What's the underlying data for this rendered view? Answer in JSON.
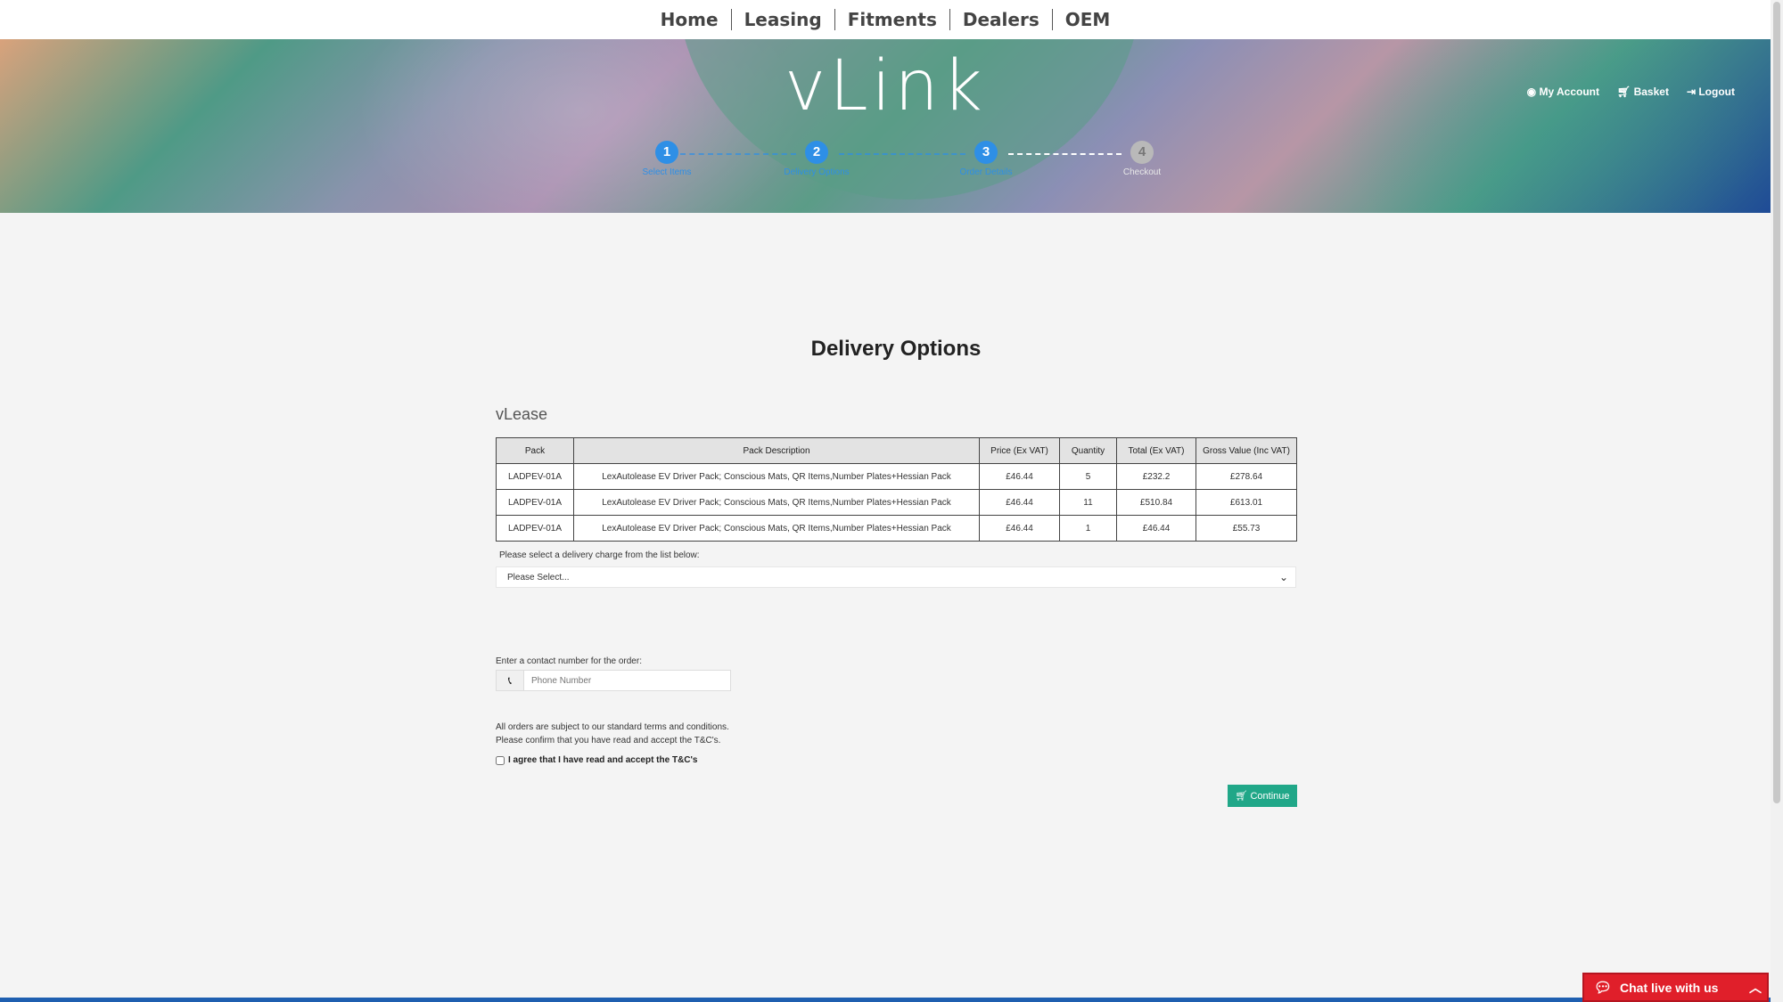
{
  "nav": {
    "items": [
      "Home",
      "Leasing",
      "Fitments",
      "Dealers",
      "OEM"
    ]
  },
  "header": {
    "logo": "vLink",
    "account": {
      "my_account": "My Account",
      "basket": "Basket",
      "logout": "Logout"
    }
  },
  "steps": [
    {
      "number": "1",
      "label": "Select Items",
      "active": true
    },
    {
      "number": "2",
      "label": "Delivery Options",
      "active": true
    },
    {
      "number": "3",
      "label": "Order Details",
      "active": true
    },
    {
      "number": "4",
      "label": "Checkout",
      "active": false
    }
  ],
  "main": {
    "title": "Delivery Options",
    "section_title": "vLease",
    "table": {
      "headers": [
        "Pack",
        "Pack Description",
        "Price (Ex VAT)",
        "Quantity",
        "Total (Ex VAT)",
        "Gross Value (Inc VAT)"
      ],
      "rows": [
        [
          "LADPEV-01A",
          "LexAutolease EV Driver Pack; Conscious Mats, QR Items,Number Plates+Hessian Pack",
          "£46.44",
          "5",
          "£232.2",
          "£278.64"
        ],
        [
          "LADPEV-01A",
          "LexAutolease EV Driver Pack; Conscious Mats, QR Items,Number Plates+Hessian Pack",
          "£46.44",
          "11",
          "£510.84",
          "£613.01"
        ],
        [
          "LADPEV-01A",
          "LexAutolease EV Driver Pack; Conscious Mats, QR Items,Number Plates+Hessian Pack",
          "£46.44",
          "1",
          "£46.44",
          "£55.73"
        ]
      ]
    },
    "delivery_label": "Please select a delivery charge from the list below:",
    "delivery_select_value": "Please Select...",
    "contact_label": "Enter a contact number for the order:",
    "phone_placeholder": "Phone Number",
    "terms_line1": "All orders are subject to our standard terms and conditions.",
    "terms_line2": "Please confirm that you have read and accept the T&C's.",
    "agree_label": "I agree that I have read and accept the T&C's",
    "continue_label": "Continue"
  },
  "chat": {
    "label": "Chat live with us"
  },
  "colors": {
    "accent": "#2e8fe6",
    "continue": "#20a788",
    "chat": "#e01f2a"
  }
}
